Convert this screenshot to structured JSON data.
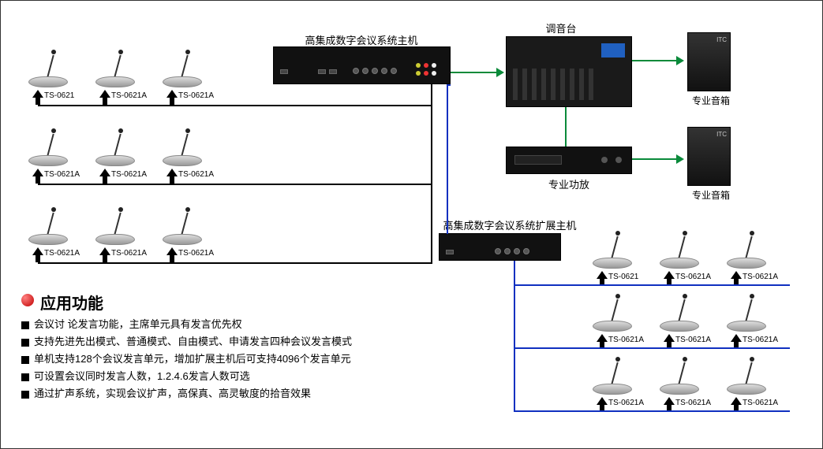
{
  "labels": {
    "main_host": "高集成数字会议系统主机",
    "mixer": "调音台",
    "amp": "专业功放",
    "speaker": "专业音箱",
    "ext_host": "高集成数字会议系统扩展主机",
    "speaker_logo": "ITC"
  },
  "mic_labels": {
    "left": [
      [
        "TS-0621",
        "TS-0621A",
        "TS-0621A"
      ],
      [
        "TS-0621A",
        "TS-0621A",
        "TS-0621A"
      ],
      [
        "TS-0621A",
        "TS-0621A",
        "TS-0621A"
      ]
    ],
    "right": [
      [
        "TS-0621",
        "TS-0621A",
        "TS-0621A"
      ],
      [
        "TS-0621A",
        "TS-0621A",
        "TS-0621A"
      ],
      [
        "TS-0621A",
        "TS-0621A",
        "TS-0621A"
      ]
    ]
  },
  "section_title": "应用功能",
  "features": [
    "会议讨 论发言功能，主席单元具有发言优先权",
    "支持先进先出模式、普通模式、自由模式、申请发言四种会议发言模式",
    "单机支持128个会议发言单元，增加扩展主机后可支持4096个发言单元",
    "可设置会议同时发言人数，1.2.4.6发言人数可选",
    "通过扩声系统，实现会议扩声，高保真、高灵敏度的拾音效果"
  ],
  "colors": {
    "wire_black": "#000000",
    "wire_blue": "#1030c0",
    "wire_green": "#0a8a3a"
  }
}
